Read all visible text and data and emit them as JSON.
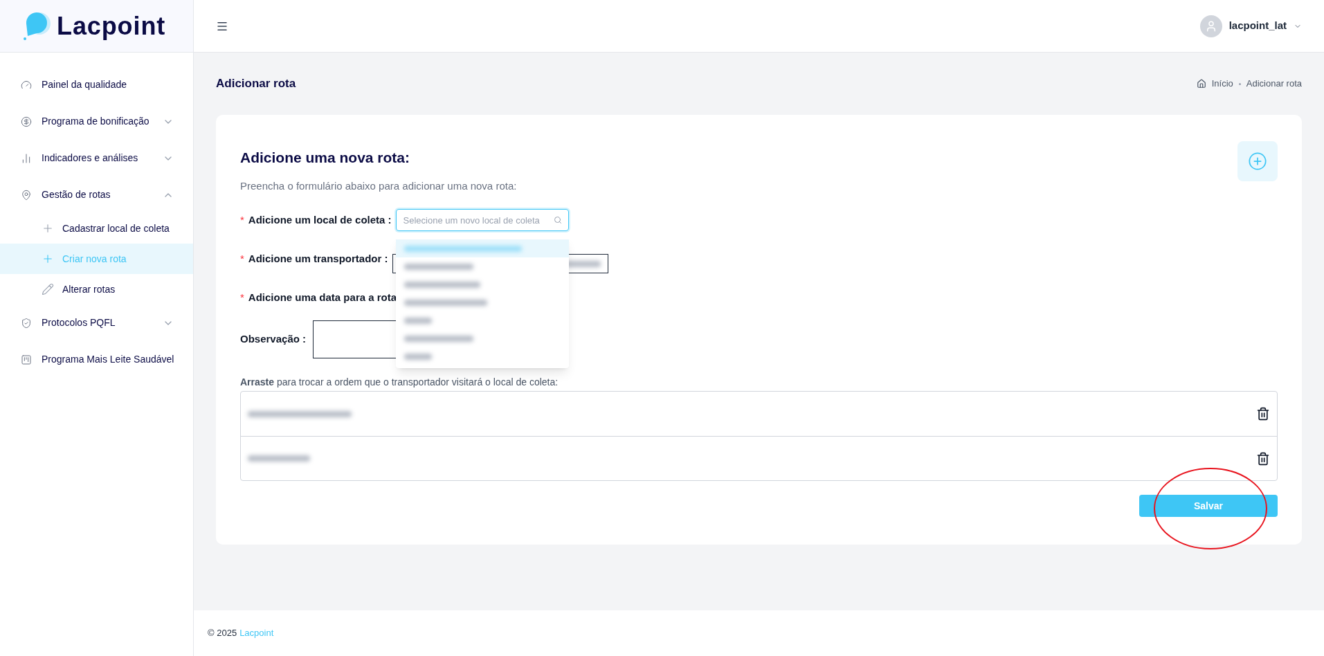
{
  "logo": {
    "text": "Lacpoint"
  },
  "sidebar": {
    "items": [
      {
        "label": "Painel da qualidade"
      },
      {
        "label": "Programa de bonificação",
        "expanded": false
      },
      {
        "label": "Indicadores e análises",
        "expanded": false
      },
      {
        "label": "Gestão de rotas",
        "expanded": true,
        "children": [
          {
            "label": "Cadastrar local de coleta",
            "selected": false
          },
          {
            "label": "Criar nova rota",
            "selected": true
          },
          {
            "label": "Alterar rotas",
            "selected": false
          }
        ]
      },
      {
        "label": "Protocolos PQFL",
        "expanded": false
      },
      {
        "label": "Programa Mais Leite Saudável"
      }
    ]
  },
  "header": {
    "user": "lacpoint_lat"
  },
  "page": {
    "title": "Adicionar rota",
    "breadcrumb": [
      "Início",
      "Adicionar rota"
    ]
  },
  "form": {
    "heading": "Adicione uma nova rota:",
    "subtitle": "Preencha o formulário abaixo para adicionar uma nova rota:",
    "fields": [
      {
        "kind": "search",
        "asterisk": "*",
        "label": "Adicione um local de coleta :",
        "placeholder": "Selecione um novo local de coleta",
        "focused": true
      },
      {
        "kind": "select",
        "asterisk": "*",
        "label": "Adicione um transportador :"
      },
      {
        "kind": "date",
        "asterisk": "*",
        "label": "Adicione uma data para a rota"
      },
      {
        "kind": "textarea",
        "label": "Observação :"
      }
    ],
    "dropdown": {
      "open": true,
      "options": [
        {
          "selected": true
        },
        {
          "selected": false
        },
        {
          "selected": false
        },
        {
          "selected": false
        },
        {
          "selected": false
        },
        {
          "selected": false
        },
        {
          "selected": false
        }
      ]
    },
    "drag_hint": "**Arraste** para trocar a ordem que o transportador visitará o local de coleta:",
    "route_stops": [
      {
        "kind": "redacted"
      },
      {
        "kind": "redacted"
      }
    ],
    "save_button": "Salvar"
  },
  "annotation": {
    "kind": "ellipse"
  },
  "footer": {
    "year": "© 2025",
    "brand": "Lacpoint"
  }
}
